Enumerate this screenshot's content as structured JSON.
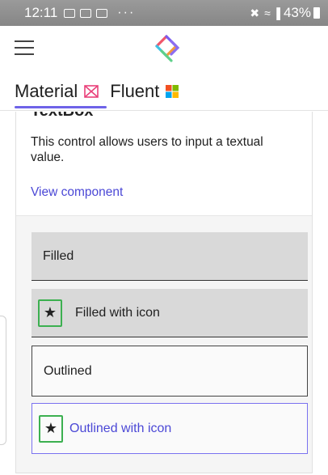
{
  "status_bar": {
    "time": "12:11",
    "overflow": "···",
    "battery": "43%"
  },
  "app": {
    "menu_icon": "hamburger-icon",
    "logo_icon": "uno-platform-logo"
  },
  "tabs": [
    {
      "label": "Material",
      "icon": "material-icon",
      "selected": true
    },
    {
      "label": "Fluent",
      "icon": "fluent-icon",
      "selected": false
    }
  ],
  "card": {
    "title": "TextBox",
    "description": "This control allows users to input a textual value.",
    "link": "View component"
  },
  "fields": [
    {
      "label": "Filled",
      "style": "filled",
      "icon": null
    },
    {
      "label": "Filled with icon",
      "style": "filled",
      "icon": "star-icon"
    },
    {
      "label": "Outlined",
      "style": "outlined",
      "icon": null
    },
    {
      "label": "Outlined with icon",
      "style": "outlined",
      "icon": "star-icon"
    }
  ],
  "colors": {
    "accent": "#6e63e8",
    "link": "#4b48d6",
    "icon_highlight": "#3cb050",
    "filled_bg": "#d9d9d9"
  }
}
